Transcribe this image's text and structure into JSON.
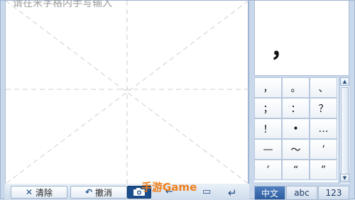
{
  "writing_area": {
    "hint": "请在米字格内手写输入"
  },
  "toolbar": {
    "clear_label": "清除",
    "undo_label": "撤消",
    "clear_icon": "close-icon",
    "undo_icon": "undo-icon",
    "camera_icon": "camera-icon"
  },
  "preview": {
    "char": "，"
  },
  "symbols": [
    [
      "，",
      "。",
      "、"
    ],
    [
      "；",
      "：",
      "？"
    ],
    [
      "！",
      "•",
      "…"
    ],
    [
      "—",
      "～",
      "‘"
    ],
    [
      "’",
      "“",
      "”"
    ]
  ],
  "modes": [
    {
      "label": "中文",
      "active": true
    },
    {
      "label": "abc",
      "active": false
    },
    {
      "label": "123",
      "active": false
    }
  ],
  "watermark": "手游Game"
}
